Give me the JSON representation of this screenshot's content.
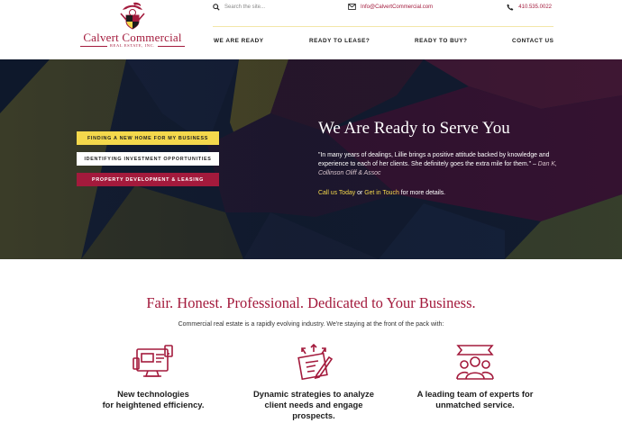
{
  "brand": {
    "name": "Calvert Commercial",
    "subtitle": "REAL ESTATE, INC."
  },
  "topbar": {
    "search_placeholder": "Search the site...",
    "email": "Info@CalvertCommercial.com",
    "phone": "410.535.0022"
  },
  "nav": {
    "items": [
      {
        "label": "WE ARE READY"
      },
      {
        "label": "READY TO LEASE?"
      },
      {
        "label": "READY TO BUY?"
      },
      {
        "label": "CONTACT US"
      }
    ]
  },
  "hero": {
    "buttons": [
      {
        "label": "FINDING A NEW HOME FOR MY BUSINESS"
      },
      {
        "label": "IDENTIFYING INVESTMENT OPPORTUNITIES"
      },
      {
        "label": "PROPERTY DEVELOPMENT & LEASING"
      }
    ],
    "title": "We Are Ready to Serve You",
    "quote": "\"In many years of dealings, Lillie brings a positive attitude backed by knowledge and experience to each of her clients. She definitely goes the extra mile for them.\" –",
    "quote_author": "Dan K, Collinson Oliff & Assoc",
    "cta": {
      "link1": "Call us Today",
      "sep": " or ",
      "link2": "Get in Touch",
      "tail": " for more details."
    }
  },
  "features": {
    "tagline": "Fair. Honest. Professional. Dedicated to Your Business.",
    "intro": "Commercial real estate is a rapidly evolving industry. We're staying at the front of the pack with:",
    "items": [
      {
        "line1": "New technologies",
        "line2": "for heightened efficiency.",
        "line3": "",
        "icon": "computer-icon"
      },
      {
        "line1": "Dynamic strategies to analyze",
        "line2": "client needs and engage",
        "line3": "prospects.",
        "icon": "strategy-icon"
      },
      {
        "line1": "A leading team of experts for",
        "line2": "unmatched service.",
        "line3": "",
        "icon": "team-icon"
      }
    ]
  },
  "colors": {
    "brand_red": "#a31a3c",
    "brand_yellow": "#f4d84c",
    "navy": "#0f1a2e"
  }
}
